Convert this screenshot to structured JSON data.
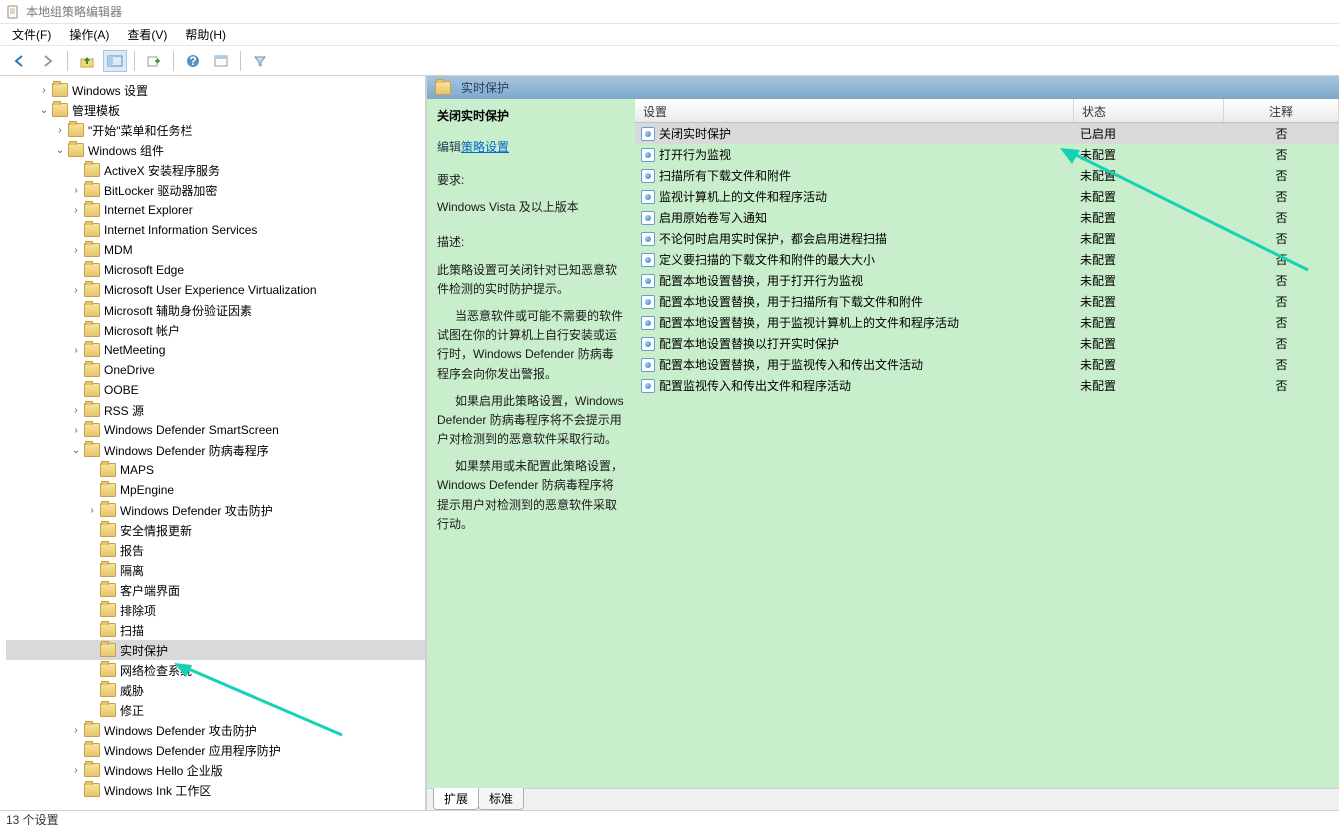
{
  "window": {
    "title": "本地组策略编辑器"
  },
  "menu": {
    "file": "文件(F)",
    "action": "操作(A)",
    "view": "查看(V)",
    "help": "帮助(H)"
  },
  "tree": {
    "n0": "Windows 设置",
    "n1": "管理模板",
    "n2": "\"开始\"菜单和任务栏",
    "n3": "Windows 组件",
    "n4": "ActiveX 安装程序服务",
    "n5": "BitLocker 驱动器加密",
    "n6": "Internet Explorer",
    "n7": "Internet Information Services",
    "n8": "MDM",
    "n9": "Microsoft Edge",
    "n10": "Microsoft User Experience Virtualization",
    "n11": "Microsoft 辅助身份验证因素",
    "n12": "Microsoft 帐户",
    "n13": "NetMeeting",
    "n14": "OneDrive",
    "n15": "OOBE",
    "n16": "RSS 源",
    "n17": "Windows Defender SmartScreen",
    "n18": "Windows Defender 防病毒程序",
    "n19": "MAPS",
    "n20": "MpEngine",
    "n21": "Windows Defender 攻击防护",
    "n22": "安全情报更新",
    "n23": "报告",
    "n24": "隔离",
    "n25": "客户端界面",
    "n26": "排除项",
    "n27": "扫描",
    "n28": "实时保护",
    "n29": "网络检查系统",
    "n30": "威胁",
    "n31": "修正",
    "n32": "Windows Defender 攻击防护",
    "n33": "Windows Defender 应用程序防护",
    "n34": "Windows Hello 企业版",
    "n35": "Windows Ink 工作区"
  },
  "detail": {
    "header": "实时保护",
    "title": "关闭实时保护",
    "editLabel": "编辑",
    "editLink": "策略设置",
    "reqLabel": "要求:",
    "reqText": "Windows Vista 及以上版本",
    "descLabel": "描述:",
    "desc1": "此策略设置可关闭针对已知恶意软件检测的实时防护提示。",
    "desc2": "当恶意软件或可能不需要的软件试图在你的计算机上自行安装或运行时，Windows Defender 防病毒程序会向你发出警报。",
    "desc3": "如果启用此策略设置，Windows Defender 防病毒程序将不会提示用户对检测到的恶意软件采取行动。",
    "desc4": "如果禁用或未配置此策略设置，Windows Defender 防病毒程序将提示用户对检测到的恶意软件采取行动。"
  },
  "columns": {
    "setting": "设置",
    "state": "状态",
    "comment": "注释"
  },
  "rows": [
    {
      "setting": "关闭实时保护",
      "state": "已启用",
      "comment": "否"
    },
    {
      "setting": "打开行为监视",
      "state": "未配置",
      "comment": "否"
    },
    {
      "setting": "扫描所有下载文件和附件",
      "state": "未配置",
      "comment": "否"
    },
    {
      "setting": "监视计算机上的文件和程序活动",
      "state": "未配置",
      "comment": "否"
    },
    {
      "setting": "启用原始卷写入通知",
      "state": "未配置",
      "comment": "否"
    },
    {
      "setting": "不论何时启用实时保护，都会启用进程扫描",
      "state": "未配置",
      "comment": "否"
    },
    {
      "setting": "定义要扫描的下载文件和附件的最大大小",
      "state": "未配置",
      "comment": "否"
    },
    {
      "setting": "配置本地设置替换，用于打开行为监视",
      "state": "未配置",
      "comment": "否"
    },
    {
      "setting": "配置本地设置替换，用于扫描所有下载文件和附件",
      "state": "未配置",
      "comment": "否"
    },
    {
      "setting": "配置本地设置替换，用于监视计算机上的文件和程序活动",
      "state": "未配置",
      "comment": "否"
    },
    {
      "setting": "配置本地设置替换以打开实时保护",
      "state": "未配置",
      "comment": "否"
    },
    {
      "setting": "配置本地设置替换，用于监视传入和传出文件活动",
      "state": "未配置",
      "comment": "否"
    },
    {
      "setting": "配置监视传入和传出文件和程序活动",
      "state": "未配置",
      "comment": "否"
    }
  ],
  "tabs": {
    "extended": "扩展",
    "standard": "标准"
  },
  "status": "13 个设置"
}
